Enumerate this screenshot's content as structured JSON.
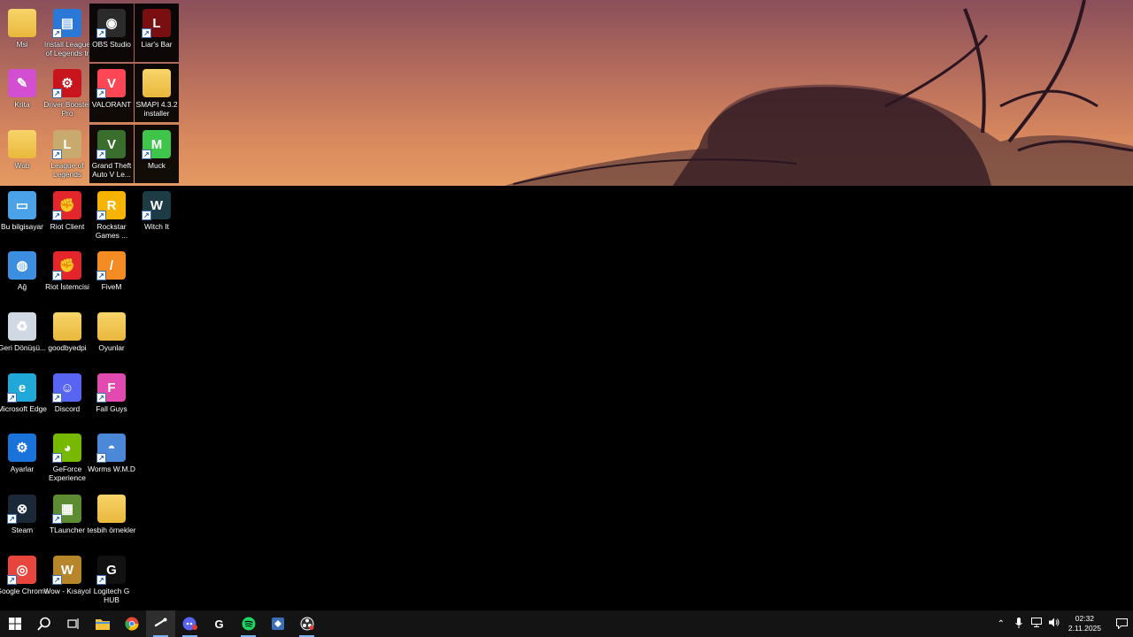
{
  "desktop": {
    "icons": [
      {
        "label": "Msi",
        "icon": "folder-icon",
        "color": "#e9b83c"
      },
      {
        "label": "Install League of Legends tr",
        "icon": "installer-window-icon",
        "color": "#2b78d6"
      },
      {
        "label": "OBS Studio",
        "icon": "obs-icon",
        "color": "#2b2b2b"
      },
      {
        "label": "Liar's Bar",
        "icon": "liars-bar-icon",
        "color": "#7a0f12"
      },
      {
        "label": "Krita",
        "icon": "krita-icon",
        "color": "#d34fd1"
      },
      {
        "label": "Driver Booster Pro",
        "icon": "driver-booster-icon",
        "color": "#c8141c"
      },
      {
        "label": "VALORANT",
        "icon": "valorant-icon",
        "color": "#ff4655"
      },
      {
        "label": "SMAPI 4.3.2 installer",
        "icon": "folder-icon",
        "color": "#f0cc5a"
      },
      {
        "label": "Wub",
        "icon": "folder-icon",
        "color": "#e9b83c"
      },
      {
        "label": "League of Legends",
        "icon": "league-icon",
        "color": "#c8aa6e"
      },
      {
        "label": "Grand Theft Auto V Le...",
        "icon": "gta-icon",
        "color": "#3a6e2c"
      },
      {
        "label": "Muck",
        "icon": "muck-icon",
        "color": "#3fc64a"
      },
      {
        "label": "Bu bilgisayar",
        "icon": "computer-icon",
        "color": "#4aa3e8"
      },
      {
        "label": "Riot Client",
        "icon": "riot-icon",
        "color": "#e2262c"
      },
      {
        "label": "Rockstar Games ...",
        "icon": "rockstar-icon",
        "color": "#f6b400"
      },
      {
        "label": "Witch It",
        "icon": "witch-it-icon",
        "color": "#1c3b45"
      },
      {
        "label": "Ağ",
        "icon": "network-icon",
        "color": "#3b8ee0"
      },
      {
        "label": "Riot İstemcisi",
        "icon": "riot-icon",
        "color": "#e2262c"
      },
      {
        "label": "FiveM",
        "icon": "fivem-icon",
        "color": "#f58b23"
      },
      {
        "label": "Geri Dönüşü...",
        "icon": "recycle-bin-icon",
        "color": "#cfd8e3"
      },
      {
        "label": "goodbyedpi",
        "icon": "folder-icon",
        "color": "#f1d680"
      },
      {
        "label": "Oyunlar",
        "icon": "folder-icon",
        "color": "#d9a95a"
      },
      {
        "label": "Microsoft Edge",
        "icon": "edge-icon",
        "color": "#1fa8d8"
      },
      {
        "label": "Discord",
        "icon": "discord-icon",
        "color": "#5865f2"
      },
      {
        "label": "Fall Guys",
        "icon": "fall-guys-icon",
        "color": "#e24ab0"
      },
      {
        "label": "Ayarlar",
        "icon": "settings-gear-icon",
        "color": "#1a73d9"
      },
      {
        "label": "GeForce Experience",
        "icon": "nvidia-icon",
        "color": "#76b900"
      },
      {
        "label": "Worms W.M.D",
        "icon": "worms-icon",
        "color": "#4c88d8"
      },
      {
        "label": "Steam",
        "icon": "steam-icon",
        "color": "#1b2838"
      },
      {
        "label": "TLauncher",
        "icon": "minecraft-grass-icon",
        "color": "#5d8b32"
      },
      {
        "label": "tesbih örnekler",
        "icon": "folder-icon",
        "color": "#f1d680"
      },
      {
        "label": "Google Chrome",
        "icon": "chrome-icon",
        "color": "#e8453c"
      },
      {
        "label": "Wow - Kısayol",
        "icon": "wow-icon",
        "color": "#b8862a"
      },
      {
        "label": "Logitech G HUB",
        "icon": "logitech-g-icon",
        "color": "#111111"
      }
    ]
  },
  "taskbar": {
    "clock_time": "02:32",
    "clock_date": "2.11.2025"
  }
}
